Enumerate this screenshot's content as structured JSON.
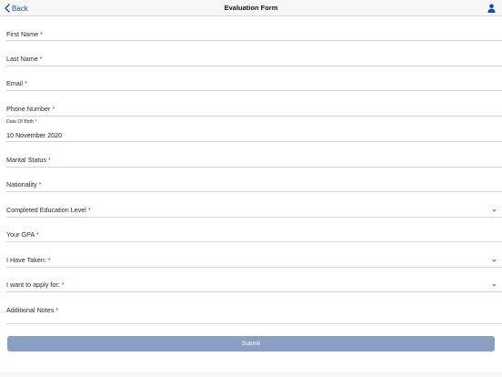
{
  "nav": {
    "back_label": "Back",
    "title": "Evaluation Form"
  },
  "fields": [
    {
      "label": "First Name",
      "required": "*"
    },
    {
      "label": "Last Name",
      "required": "*"
    },
    {
      "label": "Email",
      "required": "*"
    },
    {
      "label": "Phone Number",
      "required": "*"
    },
    {
      "label": "Date Of Birth",
      "required": "*",
      "value": "10 November 2020"
    },
    {
      "label": "Marital Status",
      "required": "*"
    },
    {
      "label": "Nationality",
      "required": "*"
    },
    {
      "label": "Completed Education Level",
      "required": "*"
    },
    {
      "label": "Your GPA",
      "required": "*"
    },
    {
      "label": "I Have Taken:",
      "required": "*"
    },
    {
      "label": "I want to apply for:",
      "required": "*"
    },
    {
      "label": "Additional Notes",
      "required": "*"
    }
  ],
  "submit_label": "Submit",
  "colors": {
    "accent": "#1b4d9e",
    "required": "#d11d1d",
    "submit_bg": "#8a9fc2"
  }
}
